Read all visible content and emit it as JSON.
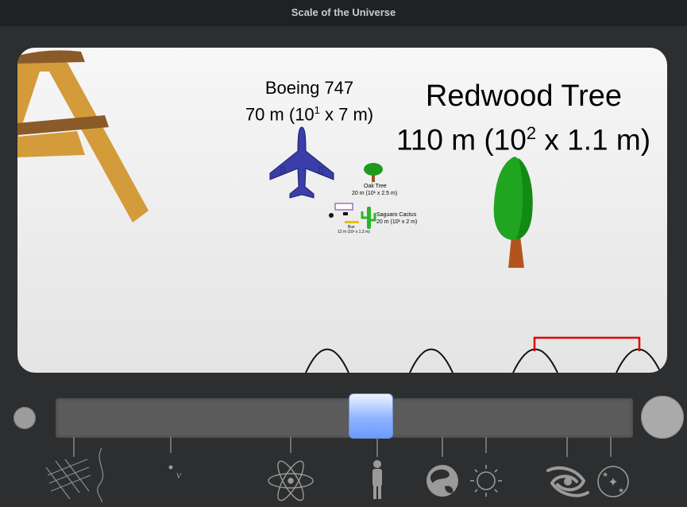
{
  "window": {
    "title": "Scale of the Universe"
  },
  "objects": {
    "boeing": {
      "name": "Boeing 747",
      "size_prefix": "70 m (10",
      "exponent": "1",
      "size_suffix": " x 7 m)"
    },
    "redwood": {
      "name": "Redwood Tree",
      "size_prefix": "110 m (10",
      "exponent": "2",
      "size_suffix": " x 1.1 m)"
    },
    "oak": {
      "name": "Oak Tree",
      "size": "20 m (10¹ x 2.5 m)"
    },
    "cactus": {
      "name": "Saguaro Cactus",
      "size": "20 m (10¹ x 2 m)"
    },
    "bus": {
      "name": "Bus",
      "size": "12 m (10¹ x 1.2 m)"
    }
  },
  "slider": {
    "position": 0.55
  },
  "icons": [
    "grid-icon",
    "string-icon",
    "neutrino-icon",
    "atom-icon",
    "person-icon",
    "earth-icon",
    "sun-icon",
    "galaxy-icon",
    "universe-icon"
  ],
  "colors": {
    "background": "#2c2e30",
    "thumb": "#8fb4ff",
    "redwood_foliage": "#1fa51f",
    "boeing": "#3a3ea8",
    "eiffel": "#d39b3a"
  }
}
